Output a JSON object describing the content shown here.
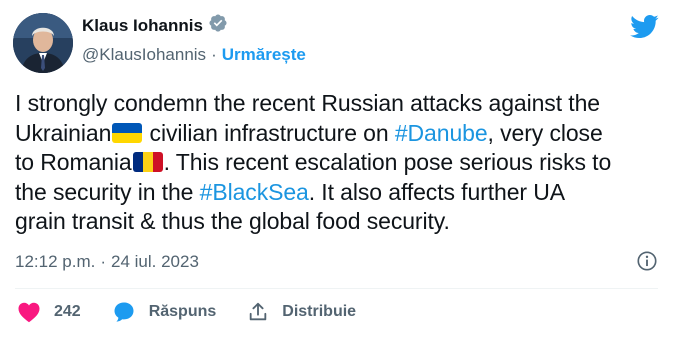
{
  "author": {
    "name": "Klaus Iohannis",
    "handle": "@KlausIohannis",
    "separator": "·",
    "follow_label": "Urmărește"
  },
  "tweet": {
    "line1": "I strongly condemn the recent Russian attacks against the",
    "line2_a": "Ukrainian",
    "line2_b": " civilian infrastructure on ",
    "hashtag_danube": "#Danube",
    "line2_c": ", very close",
    "line3_a": "to Romania",
    "line3_b": ". This recent escalation pose serious risks to",
    "line4_a": "the security in the ",
    "hashtag_blacksea": "#BlackSea",
    "line4_b": ". It also affects further UA",
    "line5": "grain transit & thus the global food security."
  },
  "meta": {
    "time": "12:12 p.m.",
    "separator": "·",
    "date": "24 iul. 2023"
  },
  "actions": {
    "likes_count": "242",
    "reply_label": "Răspuns",
    "share_label": "Distribuie"
  },
  "colors": {
    "accent": "#1d9bf0",
    "like": "#f91880",
    "text": "#0f1419",
    "muted": "#536471",
    "flag_ua_blue": "#0057b7",
    "flag_ua_yellow": "#ffd700",
    "flag_ro_blue": "#002b7f",
    "flag_ro_yellow": "#fcd116",
    "flag_ro_red": "#ce1126"
  },
  "icons": {
    "verified": "verified-badge-icon",
    "bird": "twitter-bird-icon",
    "info": "info-icon",
    "like": "heart-icon",
    "reply": "speech-bubble-icon",
    "share": "share-upload-icon"
  }
}
